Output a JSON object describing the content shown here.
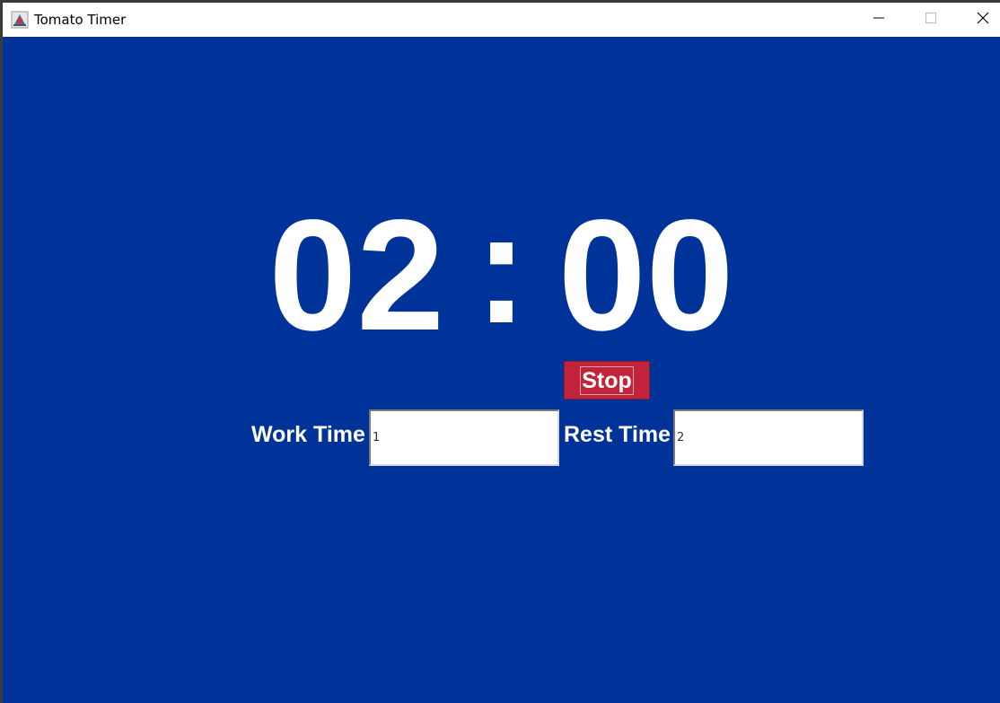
{
  "window": {
    "title": "Tomato Timer",
    "minimize_icon": "minimize-icon",
    "maximize_icon": "maximize-icon",
    "close_icon": "close-icon"
  },
  "timer": {
    "minutes": "02",
    "separator": ":",
    "seconds": "00"
  },
  "controls": {
    "stop_label": "Stop"
  },
  "settings": {
    "work_label": "Work Time",
    "work_value": "1",
    "rest_label": "Rest Time",
    "rest_value": "2"
  },
  "colors": {
    "background": "#003399",
    "stop_button": "#c0233a",
    "text": "#ffffff"
  }
}
